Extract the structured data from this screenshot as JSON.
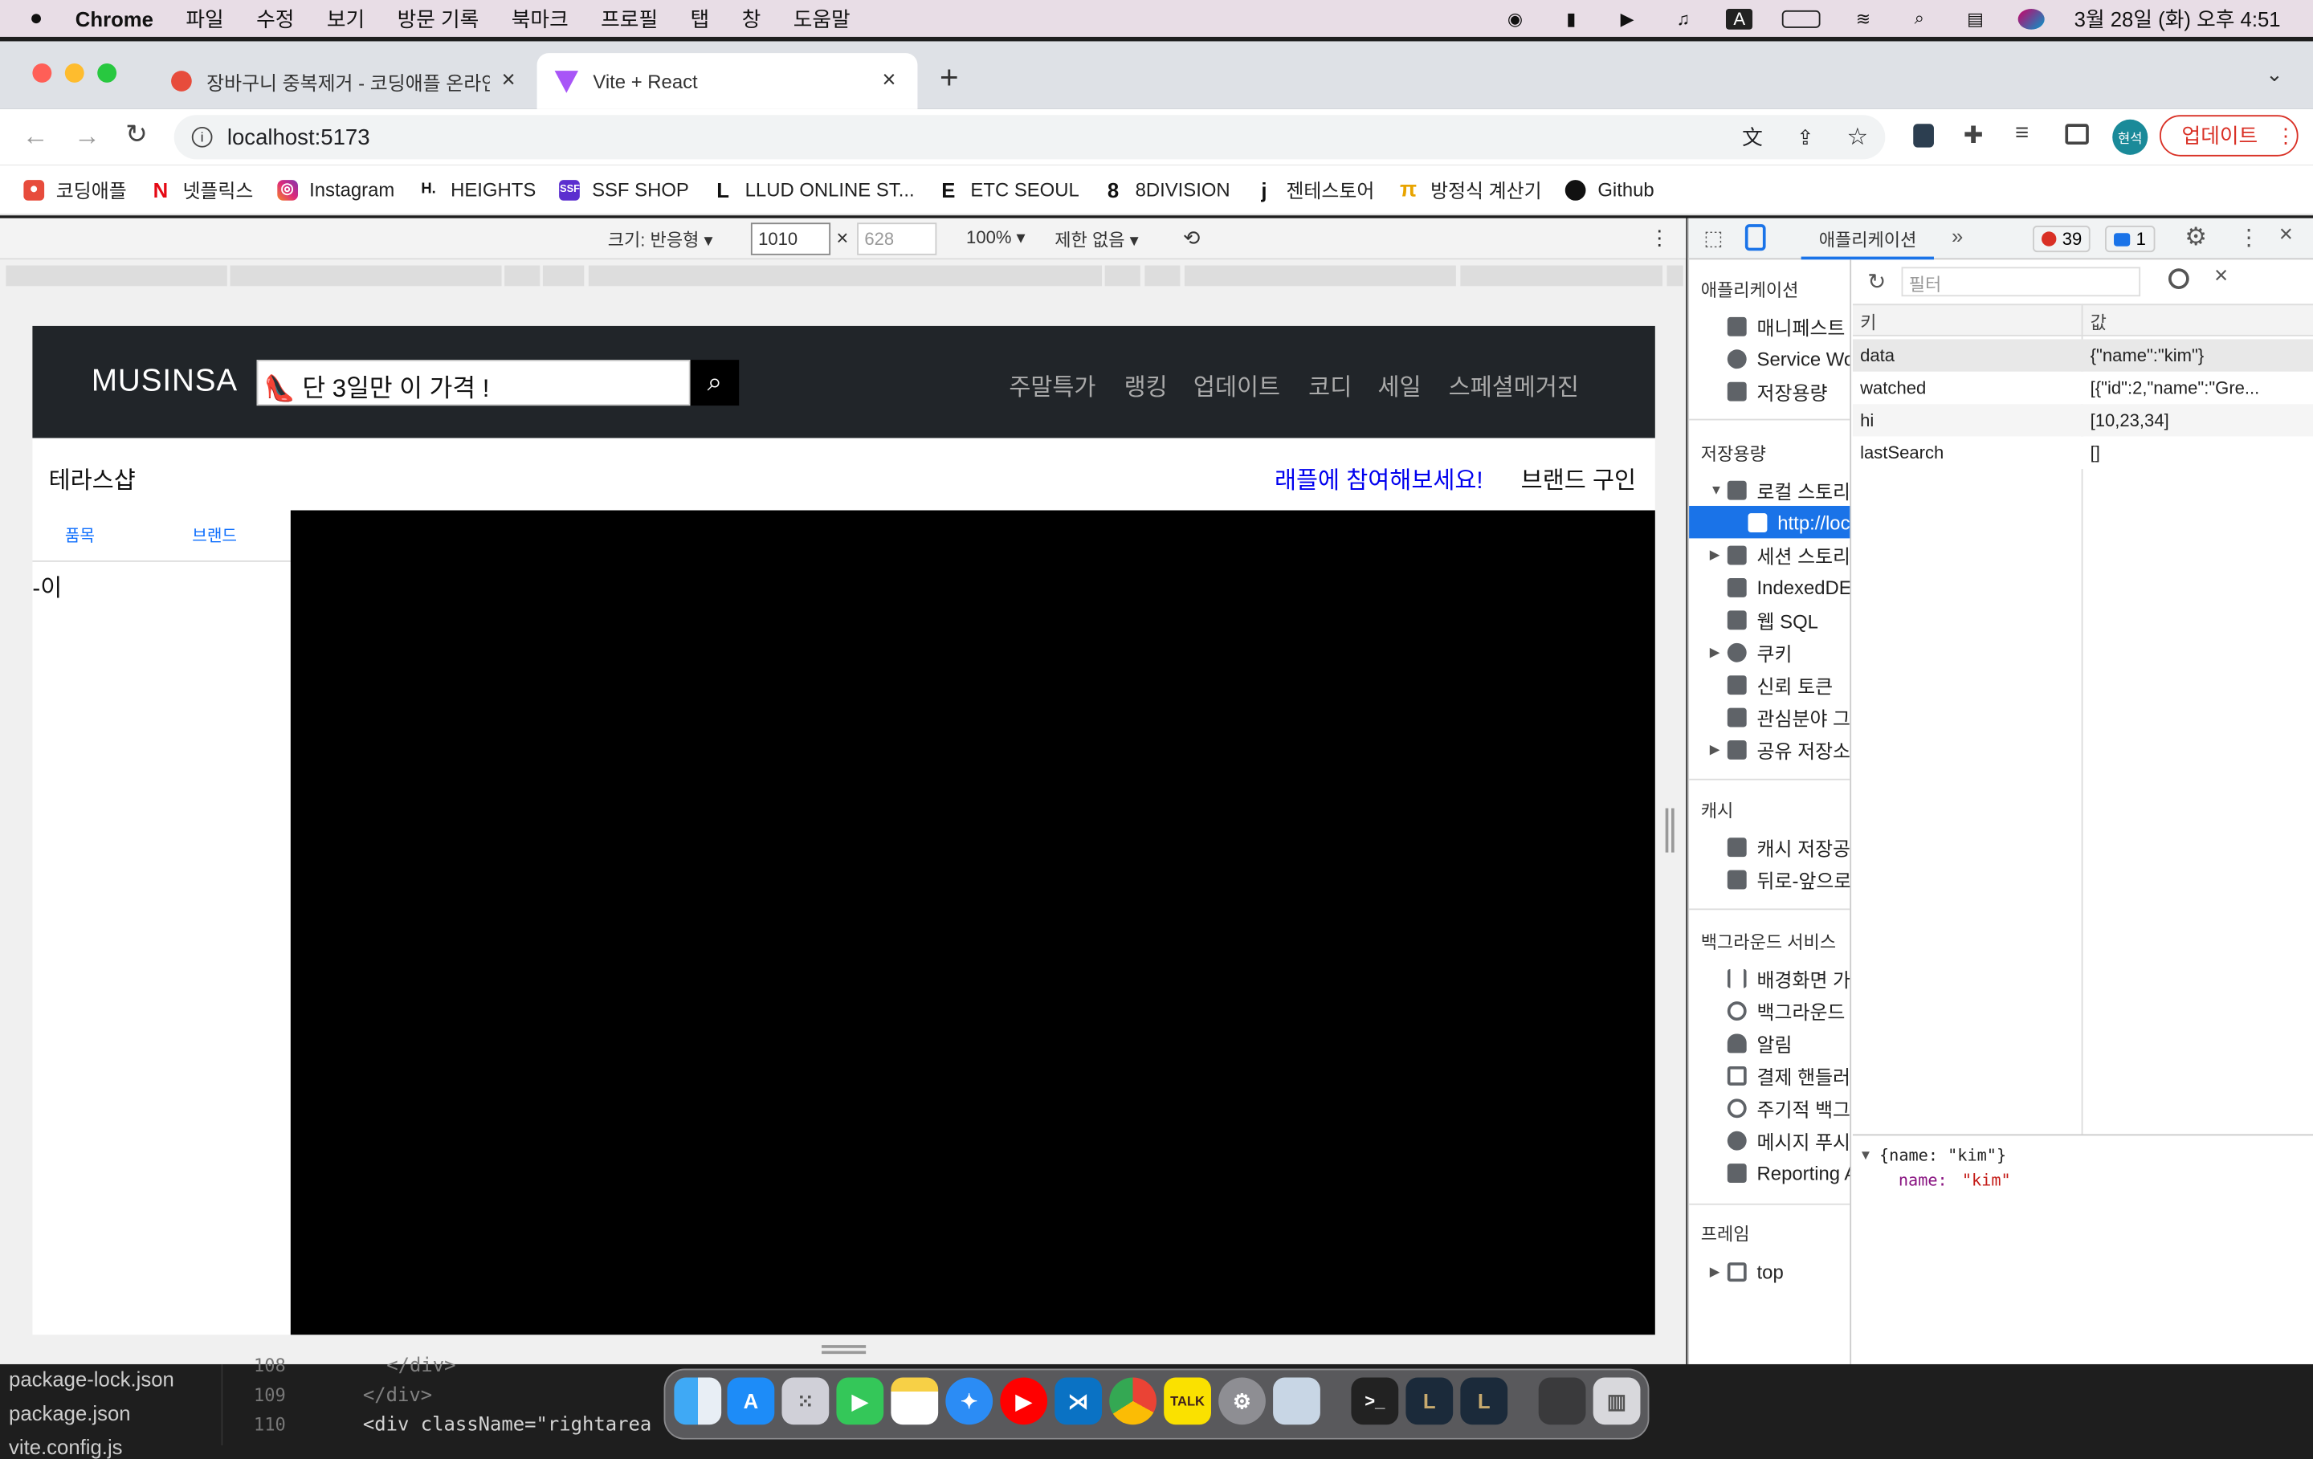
{
  "menubar": {
    "app": "Chrome",
    "items": [
      "파일",
      "수정",
      "보기",
      "방문 기록",
      "북마크",
      "프로필",
      "탭",
      "창",
      "도움말"
    ],
    "clock": "3월 28일 (화) 오후 4:51"
  },
  "tabs": [
    {
      "title": "장바구니 중복제거 - 코딩애플 온라인",
      "icon": "apple-favicon-icon"
    },
    {
      "title": "Vite + React",
      "icon": "vite-favicon-icon"
    }
  ],
  "address": {
    "url": "localhost:5173",
    "update_label": "업데이트",
    "profile_label": "현석"
  },
  "bookmarks": [
    {
      "label": "코딩애플",
      "color": "#e74c3c",
      "glyph": "🍎"
    },
    {
      "label": "넷플릭스",
      "color": "#e50914",
      "glyph": "N"
    },
    {
      "label": "Instagram",
      "color": "#c13584",
      "glyph": "◎"
    },
    {
      "label": "HEIGHTS",
      "color": "#111111",
      "glyph": "H"
    },
    {
      "label": "SSF SHOP",
      "color": "#5b2ecf",
      "glyph": "S"
    },
    {
      "label": "LLUD ONLINE ST...",
      "color": "#111111",
      "glyph": "L"
    },
    {
      "label": "ETC SEOUL",
      "color": "#111111",
      "glyph": "E"
    },
    {
      "label": "8DIVISION",
      "color": "#111111",
      "glyph": "8"
    },
    {
      "label": "젠테스토어",
      "color": "#111111",
      "glyph": "j"
    },
    {
      "label": "방정식 계산기",
      "color": "#e8a400",
      "glyph": "π"
    },
    {
      "label": "Github",
      "color": "#111111",
      "glyph": "●"
    }
  ],
  "device_toolbar": {
    "size_label": "크기: 반응형 ▾",
    "width": "1010",
    "height": "628",
    "times": "×",
    "zoom": "100% ▾",
    "throttle": "제한 없음 ▾"
  },
  "page": {
    "logo": "MUSINSA",
    "search_value": "👠 단 3일만 이 가격 !",
    "nav": [
      "주말특가",
      "랭킹",
      "업데이트",
      "코디",
      "세일",
      "스페셜메거진"
    ],
    "shop_title": "테라스샵",
    "raffle_link": "래플에 참여해보세요!",
    "brand_link": "브랜드 구인",
    "side_tabs": [
      "품목",
      "브랜드"
    ],
    "side_text": "-이"
  },
  "devtools": {
    "active_tab": "애플리케이션",
    "error_count": "39",
    "message_count": "1",
    "filter_placeholder": "필터",
    "sections": {
      "application": "애플리케이션",
      "storage": "저장용량",
      "cache": "캐시",
      "background": "백그라운드 서비스",
      "frames": "프레임"
    },
    "app_items": [
      "매니페스트",
      "Service Wo",
      "저장용량"
    ],
    "storage_items": [
      "로컬 스토리",
      "http://loc",
      "세션 스토리",
      "IndexedDE",
      "웹 SQL",
      "쿠키",
      "신뢰 토큰",
      "관심분야 그",
      "공유 저장소"
    ],
    "cache_items": [
      "캐시 저장공",
      "뒤로-앞으로"
    ],
    "bg_items": [
      "배경화면 가",
      "백그라운드",
      "알림",
      "결제 핸들러",
      "주기적 백그",
      "메시지 푸시",
      "Reporting A"
    ],
    "frame_items": [
      "top"
    ],
    "table_headers": [
      "키",
      "값"
    ],
    "rows": [
      {
        "key": "data",
        "value": "{\"name\":\"kim\"}"
      },
      {
        "key": "watched",
        "value": "[{\"id\":2,\"name\":\"Gre..."
      },
      {
        "key": "hi",
        "value": "[10,23,34]"
      },
      {
        "key": "lastSearch",
        "value": "[]"
      }
    ],
    "preview_line1": "{name: \"kim\"}",
    "preview_key": "name:",
    "preview_value": "\"kim\""
  },
  "editor": {
    "files": [
      "package-lock.json",
      "package.json",
      "vite.config.js"
    ],
    "line_numbers": [
      "108",
      "109",
      "110"
    ],
    "code_lines": [
      "</div>",
      "</div>",
      "<div className=\"rightarea"
    ]
  }
}
